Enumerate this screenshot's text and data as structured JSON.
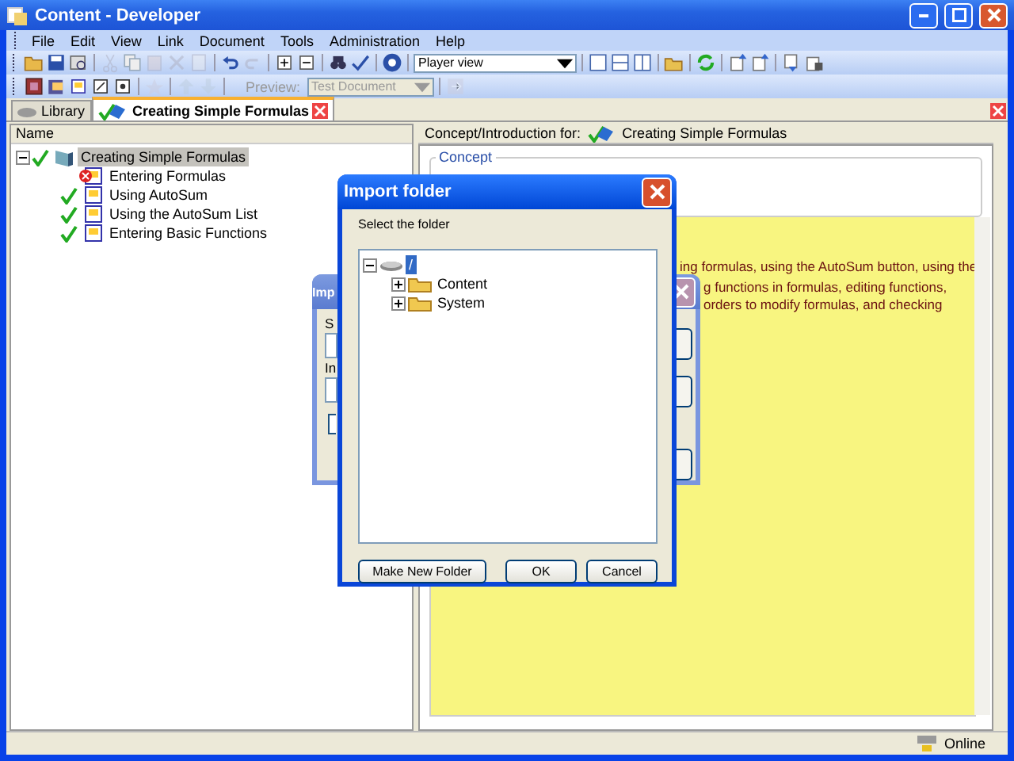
{
  "window": {
    "title": "Content - Developer"
  },
  "menu": [
    "File",
    "Edit",
    "View",
    "Link",
    "Document",
    "Tools",
    "Administration",
    "Help"
  ],
  "toolbar": {
    "view_select": {
      "value": "Player view"
    },
    "preview_label": "Preview:",
    "preview_select": {
      "value": "Test Document",
      "disabled": true
    }
  },
  "tabs": [
    {
      "label": "Library",
      "selected": false
    },
    {
      "label": "Creating Simple Formulas",
      "selected": true
    }
  ],
  "outline": {
    "column": "Name",
    "tree": [
      {
        "label": "Creating Simple Formulas",
        "selected": true,
        "expanded": true,
        "checked": true,
        "error": false,
        "children": [
          {
            "label": "Entering Formulas",
            "selected": false,
            "checked": false,
            "error": true
          },
          {
            "label": "Using AutoSum",
            "selected": false,
            "checked": true,
            "error": false
          },
          {
            "label": "Using the AutoSum List",
            "selected": false,
            "checked": true,
            "error": false
          },
          {
            "label": "Entering Basic Functions",
            "selected": false,
            "checked": true,
            "error": false
          }
        ]
      }
    ]
  },
  "concept": {
    "header": "Concept/Introduction for:",
    "header_title": "Creating Simple Formulas",
    "group": "Concept",
    "text_lines": [
      "ing formulas, using the AutoSum button, using the",
      "g functions in formulas, editing functions,",
      "orders to modify formulas, and checking"
    ]
  },
  "back_dialog": {
    "title": "Imp",
    "labels": [
      "S",
      "In"
    ],
    "checkbox": {
      "checked": false
    }
  },
  "import_dialog": {
    "title": "Import folder",
    "prompt": "Select the folder",
    "tree": [
      {
        "label": "/",
        "selected": true,
        "expanded": true,
        "children": [
          {
            "label": "Content",
            "selected": false,
            "expanded": false
          },
          {
            "label": "System",
            "selected": false,
            "expanded": false
          }
        ]
      }
    ],
    "buttons": [
      "Make New Folder",
      "OK",
      "Cancel"
    ]
  },
  "status_bar": {
    "status": "Online"
  }
}
